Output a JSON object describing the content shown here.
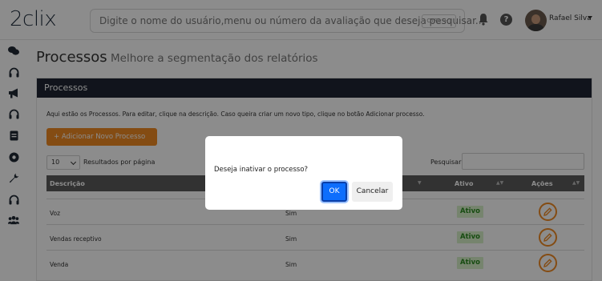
{
  "header": {
    "logo": "2clix",
    "search_placeholder": "Digite o nome do usuário,menu ou número da avaliação que deseja pesquisar...",
    "shortcut": "CTRL + /",
    "help_icon_label": "?",
    "user_name": "Rafael Silva"
  },
  "sidebar": {
    "icons": [
      "chat-icon",
      "headset-icon",
      "megaphone-icon",
      "headset-icon",
      "document-icon",
      "target-icon",
      "wrench-icon",
      "headset-icon",
      "users-icon"
    ]
  },
  "page": {
    "title": "Processos",
    "subtitle": "Melhore a segmentação dos relatórios"
  },
  "card": {
    "header": "Processos",
    "description": "Aqui estão os Processos. Para editar, clique na descrição. Caso queira criar um novo tipo, clique no botão Adicionar processo.",
    "add_button": "+ Adicionar Novo Processo",
    "page_length": "10",
    "page_length_label": "Resultados por página",
    "search_label": "Pesquisar",
    "columns": [
      "Descrição",
      "Ativo",
      "Ações"
    ],
    "rows": [
      {
        "descricao": "Voz",
        "valor": "Sim",
        "ativo": "Ativo"
      },
      {
        "descricao": "Vendas receptivo",
        "valor": "Sim",
        "ativo": "Ativo"
      },
      {
        "descricao": "Venda",
        "valor": "Sim",
        "ativo": "Ativo"
      }
    ]
  },
  "modal": {
    "message": "Deseja inativar o processo?",
    "ok": "OK",
    "cancel": "Cancelar"
  },
  "colors": {
    "accent": "#f08a24",
    "header_dark": "#1f2633",
    "primary": "#0d6efd",
    "status_active_bg": "#d7f0c9",
    "status_active_text": "#2a8a1f"
  }
}
